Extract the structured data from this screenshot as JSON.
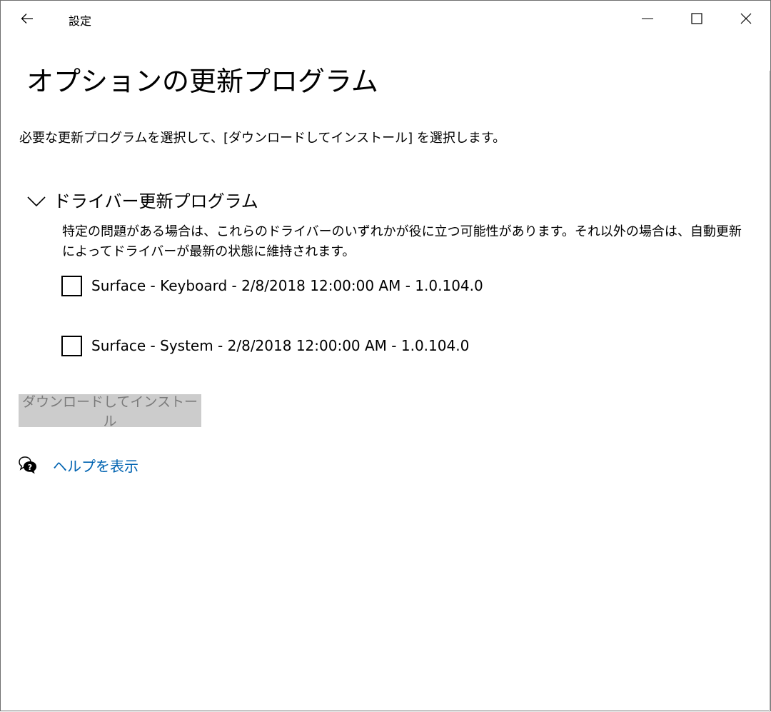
{
  "titlebar": {
    "app_title": "設定",
    "back_icon": "back-arrow-icon",
    "controls": [
      "minimize-icon",
      "maximize-icon",
      "close-icon"
    ]
  },
  "page": {
    "title": "オプションの更新プログラム",
    "description": "必要な更新プログラムを選択して、[ダウンロードしてインストール] を選択します。"
  },
  "driver_section": {
    "title": "ドライバー更新プログラム",
    "description": "特定の問題がある場合は、これらのドライバーのいずれかが役に立つ可能性があります。それ以外の場合は、自動更新によってドライバーが最新の状態に維持されます。",
    "items": [
      {
        "label": "Surface - Keyboard - 2/8/2018 12:00:00 AM - 1.0.104.0",
        "checked": false
      },
      {
        "label": "Surface - System - 2/8/2018 12:00:00 AM - 1.0.104.0",
        "checked": false
      }
    ]
  },
  "actions": {
    "install_label": "ダウンロードしてインストール",
    "install_enabled": false
  },
  "help": {
    "link_label": "ヘルプを表示",
    "icon": "help-chat-icon"
  },
  "colors": {
    "link": "#0063b1",
    "disabled_button_bg": "#cccccc",
    "disabled_button_text": "#7a7a7a"
  }
}
